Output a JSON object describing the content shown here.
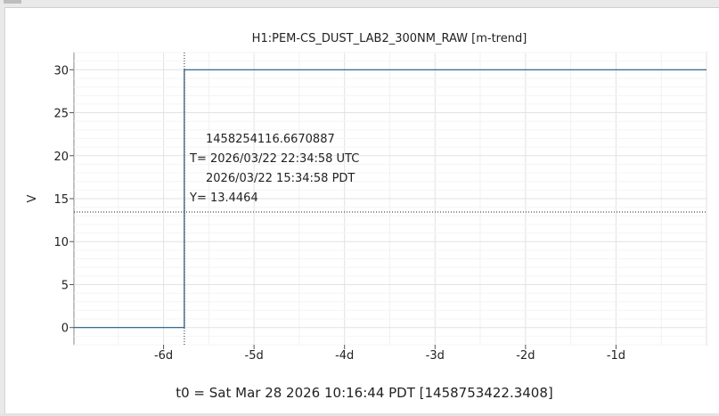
{
  "chart_data": {
    "type": "line",
    "title": "H1:PEM-CS_DUST_LAB2_300NM_RAW [m-trend]",
    "xlabel": "",
    "ylabel": "V",
    "x_unit": "days relative to t0",
    "xlim": [
      -6.99,
      0
    ],
    "ylim": [
      -2,
      32
    ],
    "x_ticks": [
      -6,
      -5,
      -4,
      -3,
      -2,
      -1
    ],
    "x_tick_labels": [
      "-6d",
      "-5d",
      "-4d",
      "-3d",
      "-2d",
      "-1d"
    ],
    "y_ticks": [
      0,
      5,
      10,
      15,
      20,
      25,
      30
    ],
    "y_tick_labels": [
      "0",
      "5",
      "10",
      "15",
      "20",
      "25",
      "30"
    ],
    "grid": true,
    "legend": "none",
    "series": [
      {
        "color": "#1f5a8a",
        "x": [
          -6.99,
          -5.77,
          -5.77,
          -5.77,
          0
        ],
        "y": [
          0,
          0,
          23.4,
          30,
          30
        ]
      }
    ],
    "cursor": {
      "x": -5.77,
      "y": 13.4464,
      "gps_label": "1458254116.6670887",
      "utc_label": "T= 2026/03/22 22:34:58 UTC",
      "pdt_label": "2026/03/22 15:34:58 PDT",
      "y_label": "Y= 13.4464"
    },
    "t0_label": "t0 = Sat Mar 28 2026 10:16:44 PDT [1458753422.3408]"
  }
}
